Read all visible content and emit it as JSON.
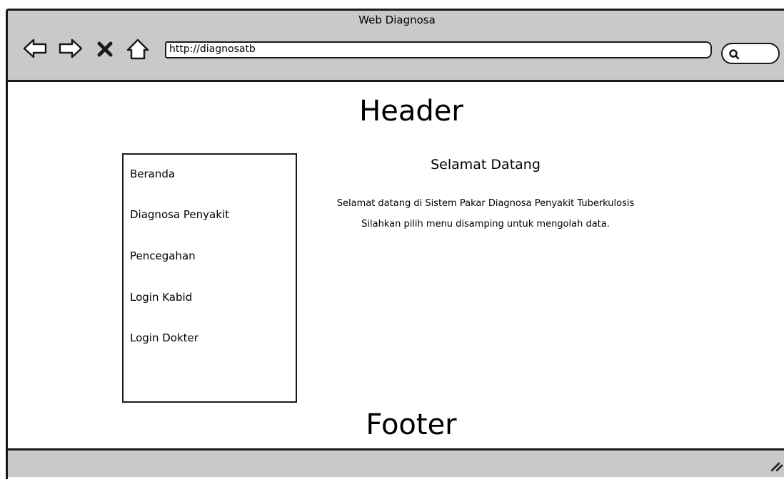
{
  "window": {
    "title": "Web Diagnosa"
  },
  "toolbar": {
    "icons": [
      "back-arrow-icon",
      "forward-arrow-icon",
      "close-x-icon",
      "home-icon",
      "search-icon"
    ],
    "url": "http://diagnosatb",
    "search_value": ""
  },
  "page": {
    "header": "Header",
    "footer": "Footer"
  },
  "sidebar": {
    "items": [
      {
        "label": "Beranda"
      },
      {
        "label": "Diagnosa Penyakit"
      },
      {
        "label": "Pencegahan"
      },
      {
        "label": "Login Kabid"
      },
      {
        "label": "Login Dokter"
      }
    ]
  },
  "main": {
    "title": "Selamat Datang",
    "lines": [
      "Selamat datang di Sistem Pakar Diagnosa Penyakit Tuberkulosis",
      "Silahkan pilih menu disamping untuk mengolah data."
    ]
  },
  "colors": {
    "chrome": "#c9c9c9",
    "stroke": "#1a1a1a",
    "background": "#ffffff"
  }
}
